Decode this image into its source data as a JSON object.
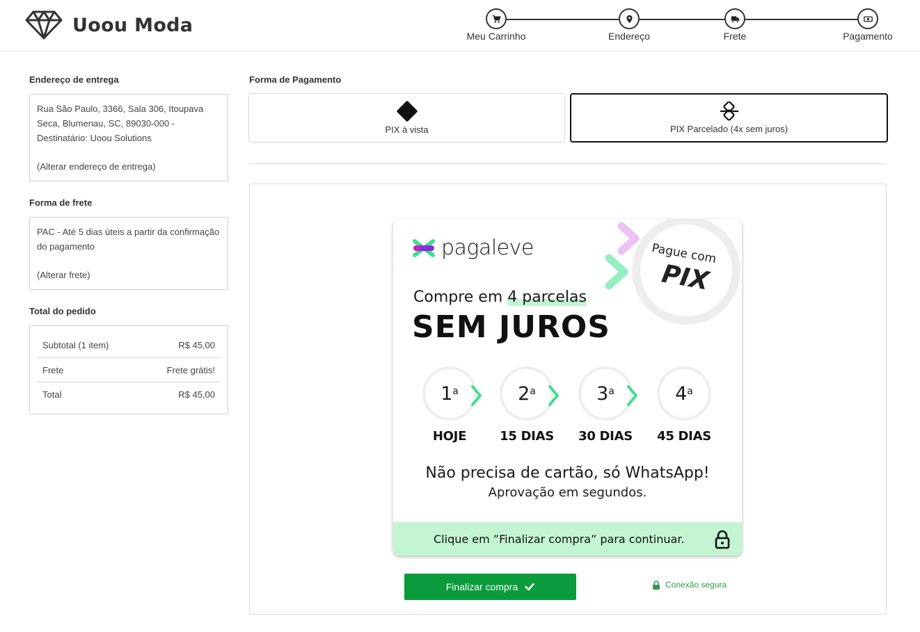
{
  "brand": {
    "name": "Uoou Moda",
    "icon": "diamond-icon"
  },
  "steps": [
    {
      "label": "Meu Carrinho",
      "icon": "cart-icon"
    },
    {
      "label": "Endereço",
      "icon": "map-pin-icon"
    },
    {
      "label": "Frete",
      "icon": "truck-icon"
    },
    {
      "label": "Pagamento",
      "icon": "money-icon"
    }
  ],
  "delivery": {
    "title": "Endereço de entrega",
    "address": "Rua São Paulo, 3366, Sala 306, Itoupava Seca, Blumenau, SC, 89030-000 - Destinatário: Uoou Solutions",
    "change_link": "(Alterar endereço de entrega)"
  },
  "shipping": {
    "title": "Forma de frete",
    "description": "PAC - Até 5 dias úteis a partir da confirmação do pagamento",
    "change_link": "(Alterar frete)"
  },
  "order": {
    "title": "Total do pedido",
    "rows": [
      {
        "label": "Subtotal (1 item)",
        "value": "R$ 45,00"
      },
      {
        "label": "Frete",
        "value": "Frete grátis!"
      },
      {
        "label": "Total",
        "value": "R$ 45,00"
      }
    ]
  },
  "payment": {
    "title": "Forma de Pagamento",
    "options": [
      {
        "label": "PIX à vista",
        "icon": "pix-icon",
        "selected": false
      },
      {
        "label": "PIX Parcelado (4x sem juros)",
        "icon": "pix-parcelado-icon",
        "selected": true
      }
    ]
  },
  "pagaleve": {
    "logo_text": "pagaleve",
    "badge_top": "Pague com",
    "badge_main": "PIX",
    "headline_pre": "Compre em ",
    "headline_highlight": "4 parcelas",
    "headline_main": "SEM JUROS",
    "installments": [
      {
        "number": "1",
        "ordinal": "a",
        "label": "HOJE"
      },
      {
        "number": "2",
        "ordinal": "a",
        "label": "15 DIAS"
      },
      {
        "number": "3",
        "ordinal": "a",
        "label": "30 DIAS"
      },
      {
        "number": "4",
        "ordinal": "a",
        "label": "45 DIAS"
      }
    ],
    "tagline": "Não precisa de cartão, só WhatsApp!",
    "subtagline": "Aprovação em segundos.",
    "footer": "Clique em ”Finalizar compra” para continuar.",
    "colors": {
      "green": "#3ee08f",
      "mint": "#c3f5d3",
      "purple": "#8a2be2",
      "magenta": "#d21cc8"
    }
  },
  "actions": {
    "finalize": "Finalizar compra",
    "secure": "Conexão segura"
  },
  "colors": {
    "primary_button": "#0b9b3c",
    "secure_text": "#2e9b4a"
  }
}
